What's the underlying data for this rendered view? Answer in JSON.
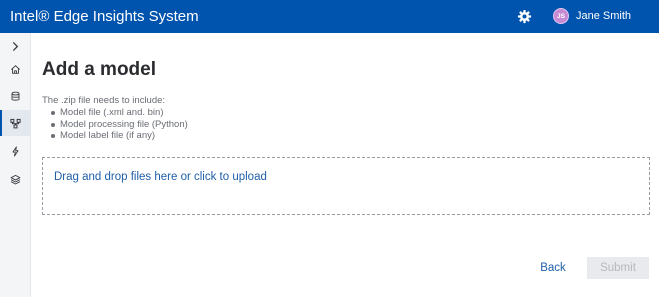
{
  "header": {
    "app_title": "Intel® Edge Insights System",
    "settings_icon": "gear-icon",
    "user": {
      "initials": "JS",
      "name": "Jane Smith",
      "avatar_color": "#c78bd6"
    },
    "background_color": "#0054ae"
  },
  "sidebar": {
    "items": [
      {
        "icon": "chevron-right-icon",
        "active": false
      },
      {
        "icon": "home-icon",
        "active": false
      },
      {
        "icon": "database-icon",
        "active": false
      },
      {
        "icon": "model-icon",
        "active": true
      },
      {
        "icon": "lightning-icon",
        "active": false
      },
      {
        "icon": "layers-icon",
        "active": false
      }
    ],
    "active_color": "#0054ae"
  },
  "main": {
    "title": "Add a model",
    "intro": "The .zip file needs to include:",
    "requirements": [
      "Model file (.xml and. bin)",
      "Model processing file (Python)",
      "Model label file (if any)"
    ],
    "dropzone_label": "Drag and drop files here or click to upload",
    "back_label": "Back",
    "submit_label": "Submit",
    "link_color": "#1f5fa9"
  }
}
